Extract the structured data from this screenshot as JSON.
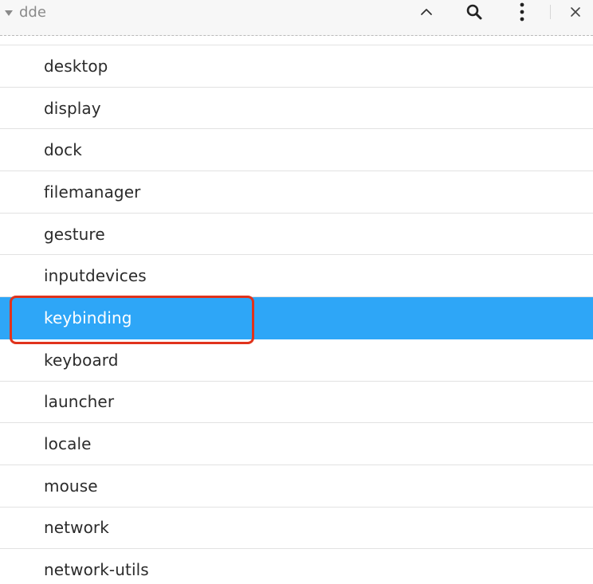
{
  "header": {
    "title": "dde",
    "icons": [
      "chevron-up-icon",
      "search-icon",
      "kebab-menu-icon",
      "close-icon"
    ]
  },
  "list": {
    "items": [
      {
        "label": "desktop"
      },
      {
        "label": "display"
      },
      {
        "label": "dock"
      },
      {
        "label": "filemanager"
      },
      {
        "label": "gesture"
      },
      {
        "label": "inputdevices"
      },
      {
        "label": "keybinding",
        "selected": true
      },
      {
        "label": "keyboard"
      },
      {
        "label": "launcher"
      },
      {
        "label": "locale"
      },
      {
        "label": "mouse"
      },
      {
        "label": "network"
      },
      {
        "label": "network-utils"
      }
    ]
  },
  "colors": {
    "selection": "#2ea6f7",
    "annotation": "#e0331c"
  }
}
